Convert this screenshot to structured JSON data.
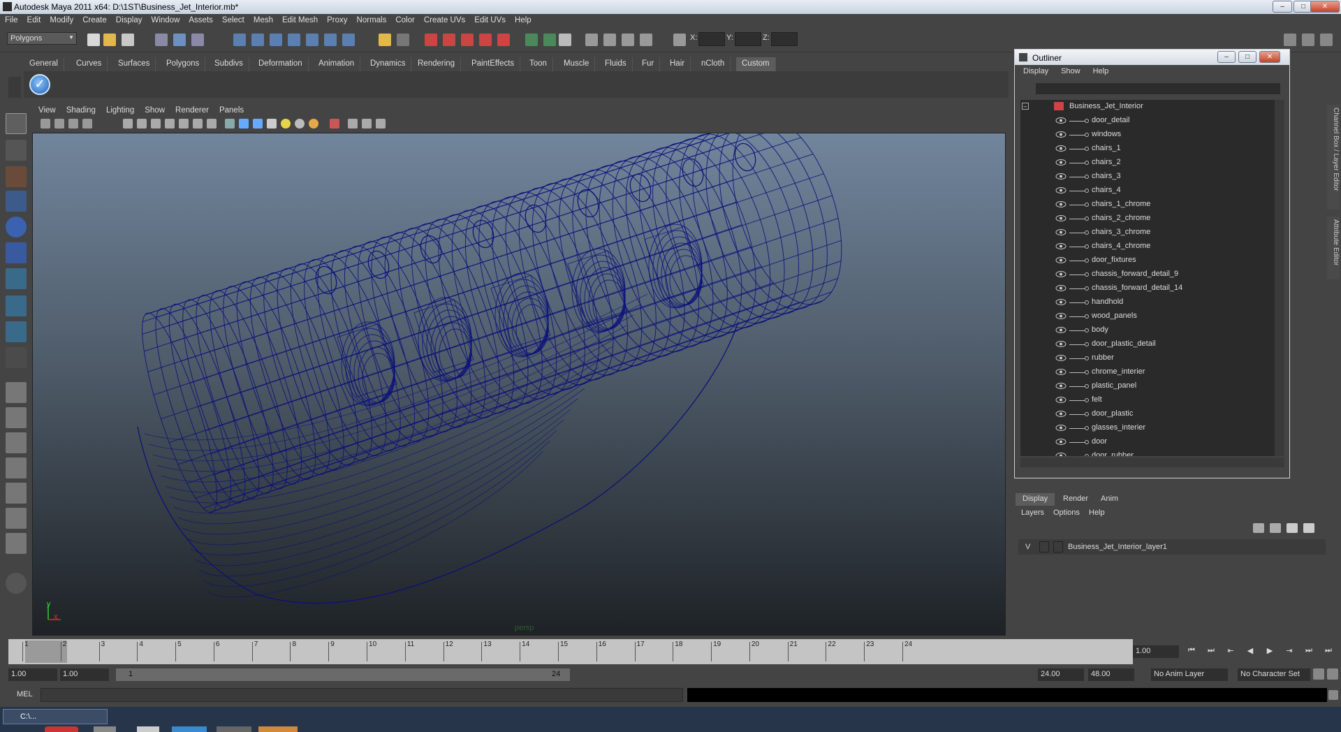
{
  "window": {
    "title": "Autodesk Maya 2011 x64: D:\\1ST\\Business_Jet_Interior.mb*"
  },
  "menubar": [
    "File",
    "Edit",
    "Modify",
    "Create",
    "Display",
    "Window",
    "Assets",
    "Select",
    "Mesh",
    "Edit Mesh",
    "Proxy",
    "Normals",
    "Color",
    "Create UVs",
    "Edit UVs",
    "Help"
  ],
  "statusline": {
    "mode": "Polygons",
    "x_label": "X:",
    "y_label": "Y:",
    "z_label": "Z:"
  },
  "shelf_tabs": [
    "General",
    "Curves",
    "Surfaces",
    "Polygons",
    "Subdivs",
    "Deformation",
    "Animation",
    "Dynamics",
    "Rendering",
    "PaintEffects",
    "Toon",
    "Muscle",
    "Fluids",
    "Fur",
    "Hair",
    "nCloth",
    "Custom"
  ],
  "shelf_active": "Custom",
  "viewport": {
    "menu": [
      "View",
      "Shading",
      "Lighting",
      "Show",
      "Renderer",
      "Panels"
    ],
    "camera_label": "persp",
    "axis_x": "x",
    "axis_y": "y",
    "wire_color": "#0a0f7a"
  },
  "outliner": {
    "title": "Outliner",
    "menu": [
      "Display",
      "Show",
      "Help"
    ],
    "root": "Business_Jet_Interior",
    "items": [
      "door_detail",
      "windows",
      "chairs_1",
      "chairs_2",
      "chairs_3",
      "chairs_4",
      "chairs_1_chrome",
      "chairs_2_chrome",
      "chairs_3_chrome",
      "chairs_4_chrome",
      "door_fixtures",
      "chassis_forward_detail_9",
      "chassis_forward_detail_14",
      "handhold",
      "wood_panels",
      "body",
      "door_plastic_detail",
      "rubber",
      "chrome_interier",
      "plastic_panel",
      "felt",
      "door_plastic",
      "glasses_interier",
      "door",
      "door_rubber"
    ]
  },
  "layers": {
    "tabs": [
      "Display",
      "Render",
      "Anim"
    ],
    "menu": [
      "Layers",
      "Options",
      "Help"
    ],
    "layer_visible": "V",
    "layer_name": "Business_Jet_Interior_layer1"
  },
  "side_tabs": {
    "channel_box": "Channel Box / Layer Editor",
    "attribute_editor": "Attribute Editor"
  },
  "time": {
    "ticks": [
      1,
      2,
      3,
      4,
      5,
      6,
      7,
      8,
      9,
      10,
      11,
      12,
      13,
      14,
      15,
      16,
      17,
      18,
      19,
      20,
      21,
      22,
      23,
      24
    ],
    "current_frame": "1.00",
    "range_start": "1.00",
    "anim_start": "1.00",
    "slider_start": "1",
    "slider_end": "24",
    "anim_end": "24.00",
    "range_end": "48.00",
    "anim_layer": "No Anim Layer",
    "character_set": "No Character Set"
  },
  "command": {
    "label": "MEL"
  },
  "taskbar": {
    "item": "C:\\..."
  }
}
